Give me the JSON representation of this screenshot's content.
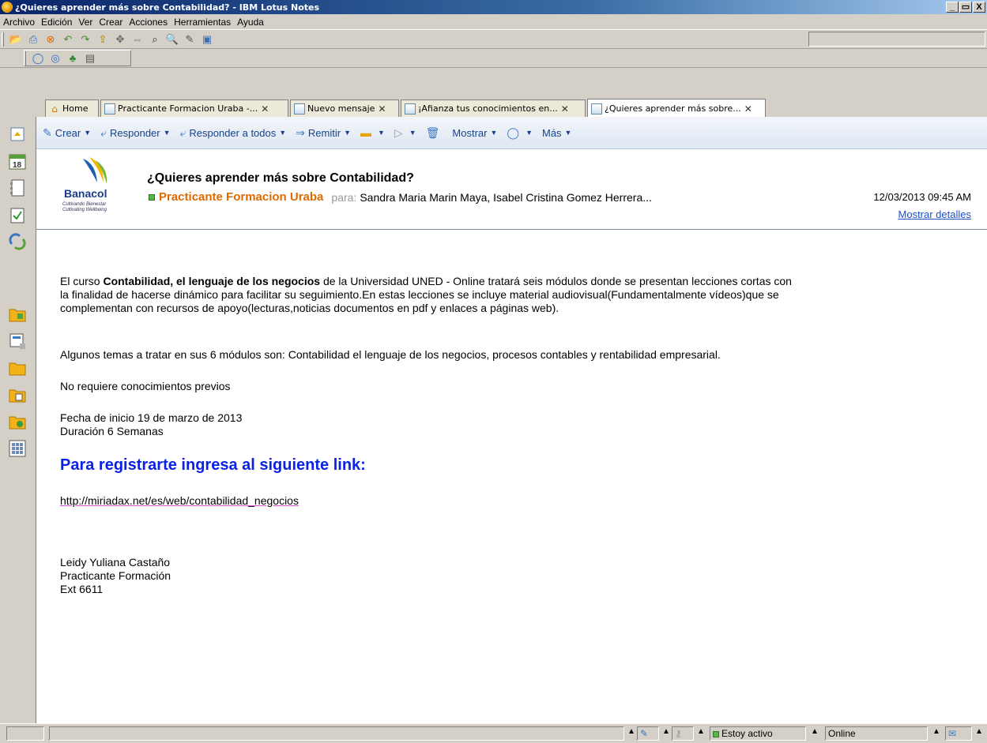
{
  "window": {
    "title": "¿Quieres aprender más sobre Contabilidad? - IBM Lotus Notes",
    "buttons": [
      "_",
      "▭",
      "X"
    ]
  },
  "menu": [
    "Archivo",
    "Edición",
    "Ver",
    "Crear",
    "Acciones",
    "Herramientas",
    "Ayuda"
  ],
  "tabs": [
    {
      "label": "Home",
      "icon": "home-icon"
    },
    {
      "label": "Practicante Formacion Uraba -...",
      "icon": "mail-icon"
    },
    {
      "label": "Nuevo mensaje",
      "icon": "mail-icon"
    },
    {
      "label": "¡Afianza tus conocimientos en...",
      "icon": "mail-icon"
    },
    {
      "label": "¿Quieres aprender más sobre...",
      "icon": "mail-icon",
      "active": true
    }
  ],
  "actions": {
    "crear": "Crear",
    "responder": "Responder",
    "responder_todos": "Responder a todos",
    "remitir": "Remitir",
    "mostrar": "Mostrar",
    "mas": "Más"
  },
  "header": {
    "logo_brand": "Banacol",
    "logo_tagline_1": "Cultivando Bienestar",
    "logo_tagline_2": "Cultivating Wellbeing",
    "subject": "¿Quieres aprender más sobre Contabilidad?",
    "sender": "Practicante Formacion Uraba",
    "para_label": "para:",
    "recipients": "Sandra Maria Marin Maya, Isabel Cristina Gomez Herrera...",
    "datetime": "12/03/2013 09:45 AM",
    "details_link": "Mostrar detalles"
  },
  "body": {
    "p1_prefix": "El curso ",
    "p1_bold": "Contabilidad, el lenguaje de los negocios",
    "p1_line1_rest": "  de la Universidad UNED - Online tratará seis módulos donde se presentan lecciones cortas con",
    "p1_line2": "la finalidad de hacerse dinámico para facilitar su seguimiento.En estas lecciones se incluye material audiovisual(Fundamentalmente vídeos)que se",
    "p1_line3": "complementan con recursos de apoyo(lecturas,noticias documentos en pdf y enlaces a páginas web).",
    "p2": "Algunos  temas a tratar en sus 6 módulos son: Contabilidad el lenguaje de los negocios, procesos contables y rentabilidad empresarial.",
    "p3": "No requiere conocimientos previos",
    "p4_line1": "Fecha de inicio 19 de marzo de 2013",
    "p4_line2": "Duración 6 Semanas",
    "heading": "Para registrarte ingresa al siguiente link:",
    "link": "http://miriadax.net/es/web/contabilidad_negocios",
    "sig_name": "Leidy Yuliana Castaño",
    "sig_title": "Practicante Formación",
    "sig_ext": "Ext 6611"
  },
  "status": {
    "presence": "Estoy activo",
    "online": "Online"
  }
}
